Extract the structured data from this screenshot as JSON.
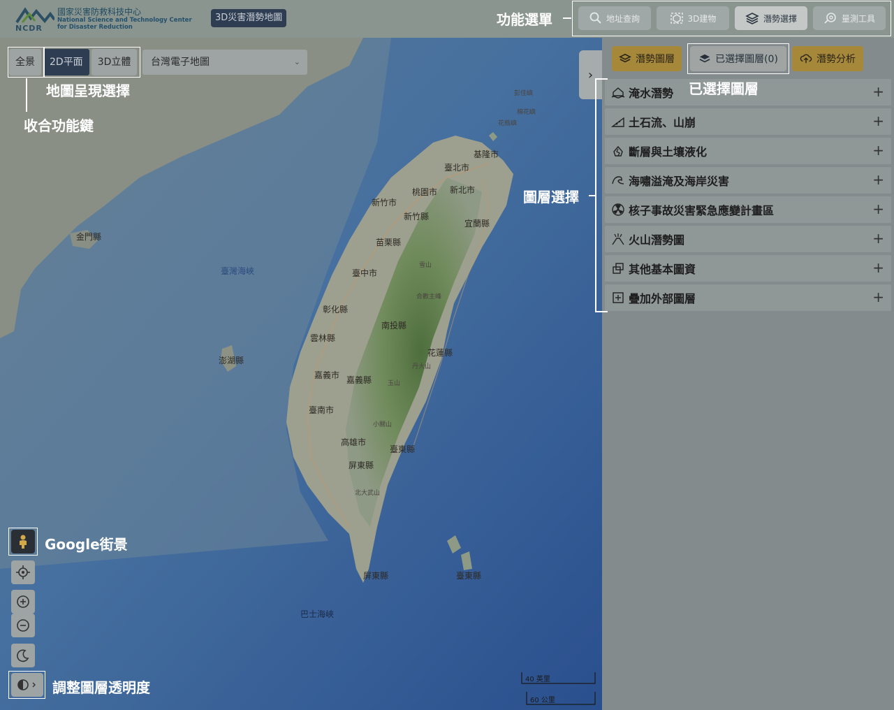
{
  "header": {
    "logo": {
      "mark": "NCDR",
      "name_zh": "國家災害防救科技中心",
      "name_en_1": "National Science and Technology Center",
      "name_en_2": "for Disaster Reduction"
    },
    "app_title": "3D災害潛勢地圖",
    "toolbar": [
      {
        "label": "地址查詢",
        "icon": "search-icon"
      },
      {
        "label": "3D建物",
        "icon": "3d-building-icon"
      },
      {
        "label": "潛勢選擇",
        "icon": "layers-icon",
        "active": true
      },
      {
        "label": "量測工具",
        "icon": "measure-icon"
      }
    ]
  },
  "map": {
    "view_buttons": [
      {
        "label": "全景",
        "active": false
      },
      {
        "label": "2D平面",
        "active": true
      },
      {
        "label": "3D立體",
        "active": false
      }
    ],
    "basemap": {
      "selected": "台灣電子地圖"
    },
    "labels": {
      "keelung": "基隆市",
      "taipei": "臺北市",
      "taoyuan": "桃園市",
      "newtaipei": "新北市",
      "hsinchu_city": "新竹市",
      "hsinchu_county": "新竹縣",
      "yilan": "宜蘭縣",
      "miaoli": "苗栗縣",
      "taichung": "臺中市",
      "xueshan": "雪山",
      "hehuan": "合歡主峰",
      "changhua": "彰化縣",
      "nantou": "南投縣",
      "yunlin": "雲林縣",
      "hualien": "花蓮縣",
      "danda": "丹大山",
      "chiayi_city": "嘉義市",
      "chiayi_county": "嘉義縣",
      "yushan": "玉山",
      "tainan": "臺南市",
      "xiaoguanshan": "小關山",
      "kaohsiung": "高雄市",
      "taitung": "臺東縣",
      "pingtung": "屏東縣",
      "beidawu": "北大武山",
      "pingtung_south": "屏東縣",
      "taitung_south": "臺東縣",
      "kinmen": "金門縣",
      "penghu": "澎湖縣",
      "strait": "臺灣海峽",
      "bashi": "巴士海峽",
      "pengjia": "彭佳嶼",
      "mianhua": "棉花嶼",
      "huaping": "花瓶嶼"
    },
    "scale": {
      "imperial": "40 英里",
      "metric": "60 公里"
    }
  },
  "panel": {
    "tabs": [
      {
        "label": "潛勢圖層",
        "icon": "layers-icon"
      },
      {
        "label": "已選擇圖層(0)",
        "icon": "selected-layers-icon"
      },
      {
        "label": "潛勢分析",
        "icon": "cloud-upload-icon"
      }
    ],
    "layers": [
      {
        "label": "淹水潛勢",
        "icon": "flood-house-icon"
      },
      {
        "label": "土石流、山崩",
        "icon": "landslide-icon"
      },
      {
        "label": "斷層與土壤液化",
        "icon": "fault-icon"
      },
      {
        "label": "海嘯溢淹及海岸災害",
        "icon": "wave-icon"
      },
      {
        "label": "核子事故災害緊急應變計畫區",
        "icon": "radiation-icon"
      },
      {
        "label": "火山潛勢圖",
        "icon": "volcano-icon"
      },
      {
        "label": "其他基本圖資",
        "icon": "copy-icon"
      },
      {
        "label": "疊加外部圖層",
        "icon": "plus-square-icon"
      }
    ],
    "plus": "+"
  },
  "annotations": {
    "function_menu": "功能選單",
    "map_view_select": "地圖呈現選擇",
    "collapse_key": "收合功能鍵",
    "selected_layers": "已選擇圖層",
    "layer_select": "圖層選擇",
    "google_streetview": "Google街景",
    "opacity": "調整圖層透明度"
  },
  "colors": {
    "accent_gold": "#a6883a",
    "dark_navy": "#2e3d52",
    "annotation": "#ffffff"
  }
}
